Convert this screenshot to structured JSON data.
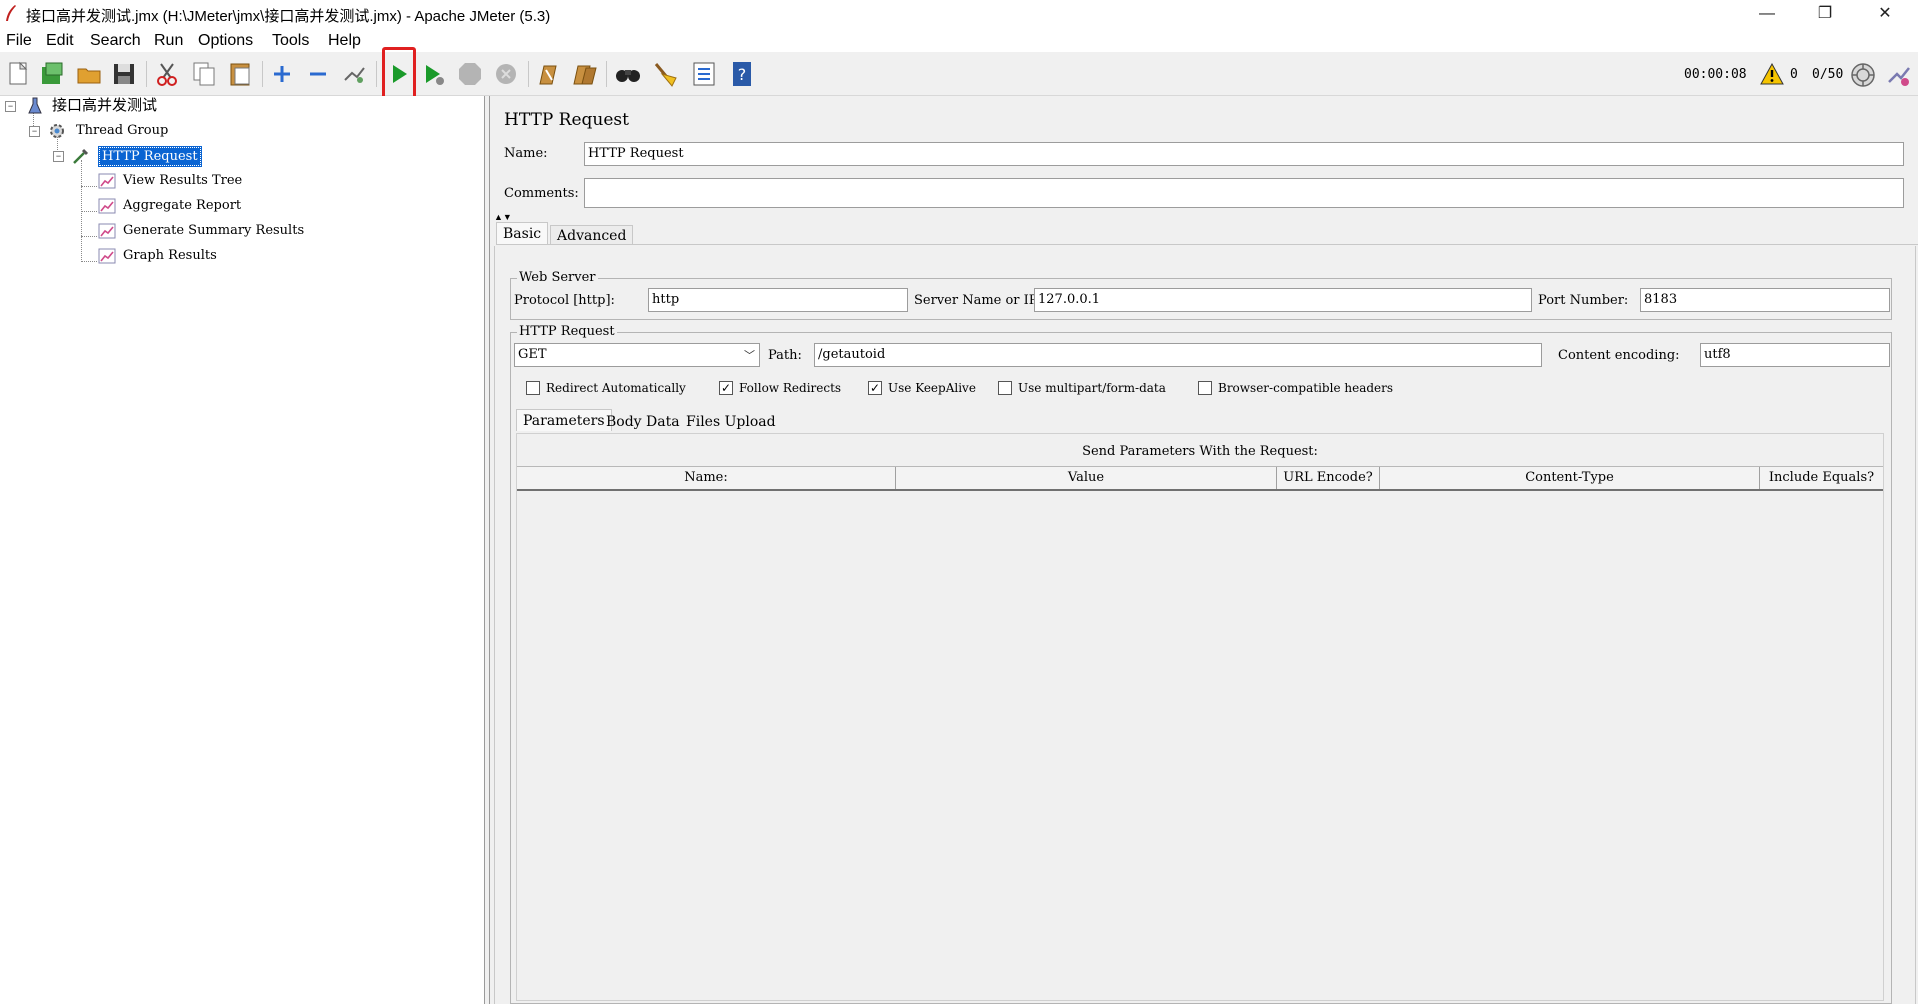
{
  "window": {
    "title": "接口高并发测试.jmx (H:\\JMeter\\jmx\\接口高并发测试.jmx) - Apache JMeter (5.3)",
    "minimize": "—",
    "restore": "❐",
    "close": "✕"
  },
  "menu": [
    "File",
    "Edit",
    "Search",
    "Run",
    "Options",
    "Tools",
    "Help"
  ],
  "toolbar": {
    "icons": [
      "new-icon",
      "templates-icon",
      "open-icon",
      "save-icon",
      "cut-icon",
      "copy-icon",
      "paste-icon",
      "expand-icon",
      "collapse-icon",
      "toggle-icon",
      "start-icon",
      "start-no-pause-icon",
      "stop-icon",
      "shutdown-icon",
      "clear-icon",
      "clear-all-icon",
      "search-icon",
      "reset-search-icon",
      "function-helper-icon",
      "help-icon"
    ],
    "timer": "00:00:08",
    "error_count": "0",
    "threads": "0/50",
    "highlight_color": "#e02020"
  },
  "tree": {
    "root": "接口高并发测试",
    "thread_group": "Thread Group",
    "sampler": "HTTP Request",
    "listeners": [
      "View Results Tree",
      "Aggregate Report",
      "Generate Summary Results",
      "Graph Results"
    ],
    "selection_color": "#0a64d2"
  },
  "panel": {
    "title": "HTTP Request",
    "name_label": "Name:",
    "name_value": "HTTP Request",
    "comments_label": "Comments:",
    "comments_value": "",
    "tabs": [
      "Basic",
      "Advanced"
    ],
    "web_server": {
      "title": "Web Server",
      "protocol_label": "Protocol [http]:",
      "protocol_value": "http",
      "server_label": "Server Name or IP:",
      "server_value": "127.0.0.1",
      "port_label": "Port Number:",
      "port_value": "8183"
    },
    "http_request": {
      "title": "HTTP Request",
      "method": "GET",
      "path_label": "Path:",
      "path_value": "/getautoid",
      "encoding_label": "Content encoding:",
      "encoding_value": "utf8"
    },
    "options": [
      {
        "label": "Redirect Automatically",
        "checked": false
      },
      {
        "label": "Follow Redirects",
        "checked": true
      },
      {
        "label": "Use KeepAlive",
        "checked": true
      },
      {
        "label": "Use multipart/form-data",
        "checked": false
      },
      {
        "label": "Browser-compatible headers",
        "checked": false
      }
    ],
    "sub_tabs": [
      "Parameters",
      "Body Data",
      "Files Upload"
    ],
    "params_caption": "Send Parameters With the Request:",
    "columns": [
      "Name:",
      "Value",
      "URL Encode?",
      "Content-Type",
      "Include Equals?"
    ]
  }
}
